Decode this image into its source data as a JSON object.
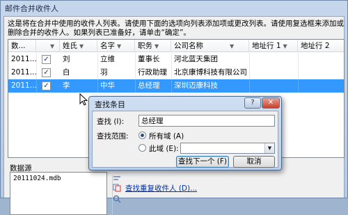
{
  "window": {
    "title": "邮件合并收件人",
    "intro_text": "这是将在合并中使用的收件人列表。请使用下面的选项向列表添加项或更改列表。请使用复选框来添加或删除合并的收件人。如果列表已准备好，请单击“确定”。"
  },
  "table": {
    "columns": [
      {
        "label": "数..."
      },
      {
        "label": "",
        "kind": "checkbox-column"
      },
      {
        "label": "姓氏"
      },
      {
        "label": "名字"
      },
      {
        "label": "职务"
      },
      {
        "label": "公司名称"
      },
      {
        "label": "地址行 1"
      },
      {
        "label": "地址行 2"
      }
    ],
    "rows": [
      {
        "source": "2011...",
        "checked": true,
        "last": "刘",
        "first": "立维",
        "title": "董事长",
        "company": "河北蓝天集团",
        "addr1": "",
        "addr2": "",
        "selected": false
      },
      {
        "source": "2011...",
        "checked": true,
        "last": "白",
        "first": "羽",
        "title": "行政助理",
        "company": "北京康博科技有限公司",
        "addr1": "",
        "addr2": "",
        "selected": false
      },
      {
        "source": "2011...",
        "checked": true,
        "last": "李",
        "first": "中华",
        "title": "总经理",
        "company": "深圳迈康科技",
        "addr1": "",
        "addr2": "",
        "selected": true
      }
    ],
    "checkmark": "✓",
    "sort_arrow": "▼"
  },
  "datasource": {
    "label": "数据源",
    "files": [
      "20111024.mdb"
    ]
  },
  "links": {
    "find_duplicates": "查找重复收件人 (D)..."
  },
  "find_dialog": {
    "title": "查找条目",
    "help_label": "?",
    "close_label": "✕",
    "find_label": "查找 (I):",
    "find_value": "总经理",
    "scope_label": "查找范围:",
    "all_fields_label": "所有域 (A)",
    "this_field_label": "此域 (E):",
    "this_field_value": "",
    "scope_selected": "all",
    "find_next_label": "查找下一个 (F)",
    "cancel_label": "取消"
  }
}
